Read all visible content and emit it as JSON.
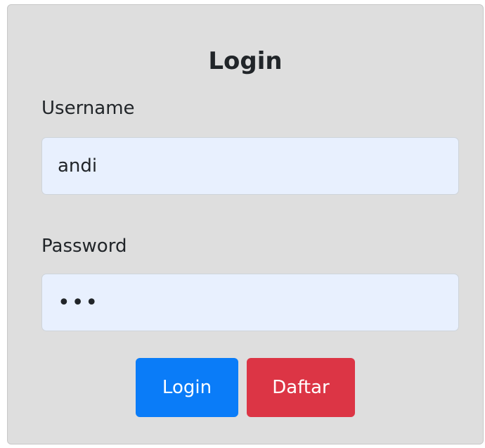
{
  "form": {
    "title": "Login",
    "username_label": "Username",
    "username_value": "andi",
    "password_label": "Password",
    "password_value": "abc",
    "login_button": "Login",
    "register_button": "Daftar"
  },
  "colors": {
    "card_background": "#dedede",
    "input_background": "#e8f0fe",
    "primary": "#0a7cf8",
    "danger": "#dc3545"
  }
}
